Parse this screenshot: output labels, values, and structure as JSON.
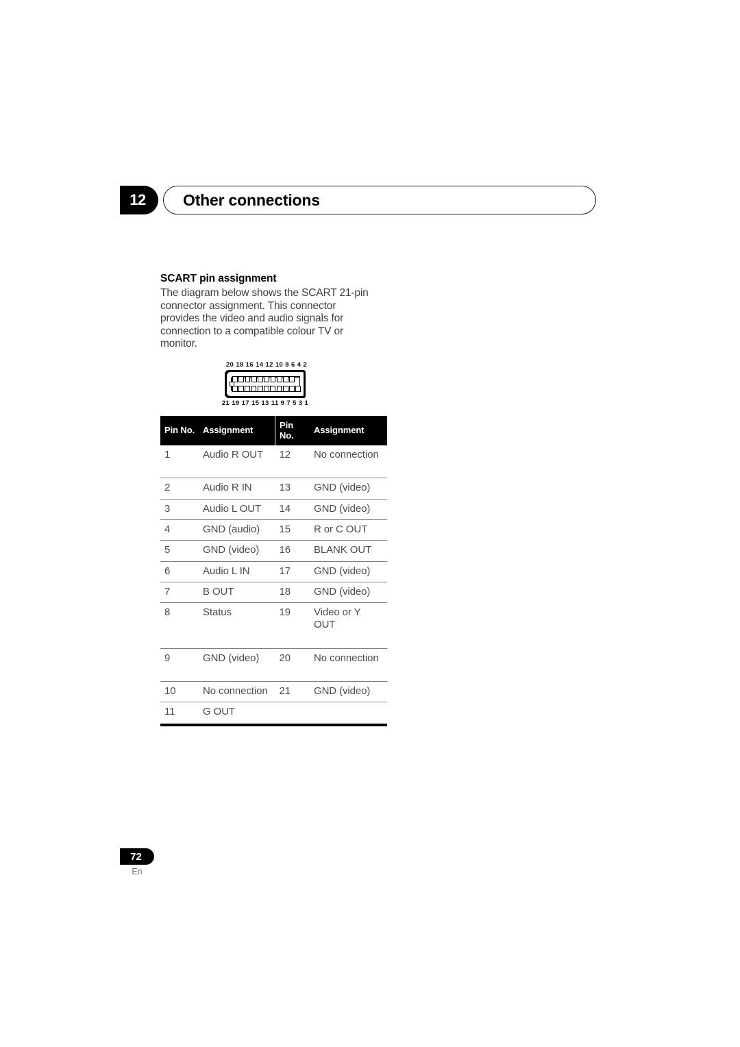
{
  "header": {
    "chapter_number": "12",
    "chapter_title": "Other connections"
  },
  "section": {
    "heading": "SCART pin assignment",
    "body": "The diagram below shows the SCART 21-pin connector assignment. This connector provides the video and audio signals for connection to a compatible colour TV or monitor."
  },
  "figure": {
    "name": "scart-connector-diagram",
    "pin_labels_top": "20 18 16 14 12 10 8 6 4 2",
    "pin_labels_bottom": "21 19 17 15 13 11 9 7 5 3 1",
    "top_row_contacts": 10,
    "bottom_row_contacts": 11
  },
  "table": {
    "headers": {
      "pin_no_1": "Pin No.",
      "assignment_1": "Assignment",
      "pin_no_2": "Pin No.",
      "assignment_2": "Assignment"
    },
    "rows": [
      {
        "pin_a": "1",
        "assign_a": "Audio R OUT",
        "pin_b": "12",
        "assign_b": "No connection",
        "tall": true
      },
      {
        "pin_a": "2",
        "assign_a": "Audio R IN",
        "pin_b": "13",
        "assign_b": "GND (video)",
        "tall": false
      },
      {
        "pin_a": "3",
        "assign_a": "Audio L OUT",
        "pin_b": "14",
        "assign_b": "GND (video)",
        "tall": false
      },
      {
        "pin_a": "4",
        "assign_a": "GND (audio)",
        "pin_b": "15",
        "assign_b": "R or C OUT",
        "tall": false
      },
      {
        "pin_a": "5",
        "assign_a": "GND (video)",
        "pin_b": "16",
        "assign_b": "BLANK OUT",
        "tall": false
      },
      {
        "pin_a": "6",
        "assign_a": "Audio L IN",
        "pin_b": "17",
        "assign_b": "GND (video)",
        "tall": false
      },
      {
        "pin_a": "7",
        "assign_a": "B OUT",
        "pin_b": "18",
        "assign_b": "GND (video)",
        "tall": false
      },
      {
        "pin_a": "8",
        "assign_a": "Status",
        "pin_b": "19",
        "assign_b": "Video or Y OUT",
        "tall": true
      },
      {
        "pin_a": "9",
        "assign_a": "GND (video)",
        "pin_b": "20",
        "assign_b": "No connection",
        "tall": true
      },
      {
        "pin_a": "10",
        "assign_a": "No connection",
        "pin_b": "21",
        "assign_b": "GND (video)",
        "tall": false
      },
      {
        "pin_a": "11",
        "assign_a": "G OUT",
        "pin_b": "",
        "assign_b": "",
        "tall": false
      }
    ]
  },
  "footer": {
    "page_number": "72",
    "language": "En"
  },
  "colors": {
    "ink": "#000000",
    "body_text": "#3f3f3f",
    "table_text": "#4a4a4a",
    "rule": "#7d7d7d",
    "footer_text": "#6b6b6b"
  }
}
